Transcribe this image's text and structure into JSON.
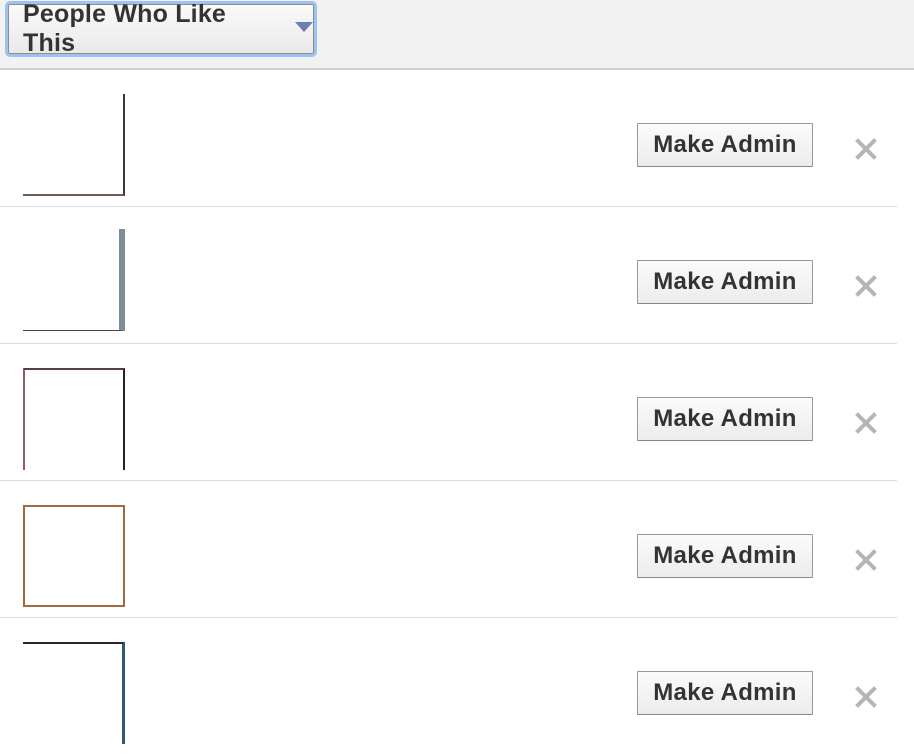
{
  "filter": {
    "label": "People Who Like This",
    "icon": "triangle-down-icon"
  },
  "rows": [
    {
      "admin_label": "Make Admin",
      "remove_icon": "close-icon"
    },
    {
      "admin_label": "Make Admin",
      "remove_icon": "close-icon"
    },
    {
      "admin_label": "Make Admin",
      "remove_icon": "close-icon"
    },
    {
      "admin_label": "Make Admin",
      "remove_icon": "close-icon"
    },
    {
      "admin_label": "Make Admin",
      "remove_icon": "close-icon"
    }
  ],
  "colors": {
    "accent_focus": "#9cc3f2",
    "caret": "#6c7fb3",
    "remove_icon": "#b5b5b5"
  }
}
